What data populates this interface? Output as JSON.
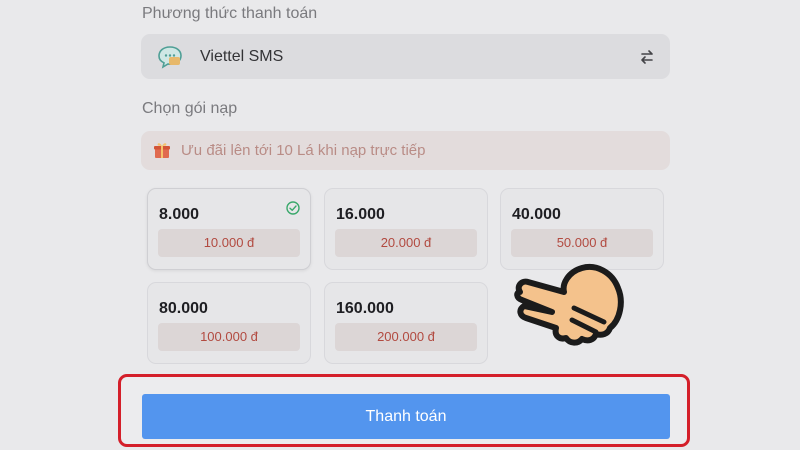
{
  "payment": {
    "label": "Phương thức thanh toán",
    "method_name": "Viettel SMS",
    "method_icon": "sms-chat-icon",
    "switch_icon": "swap-arrows-icon"
  },
  "package": {
    "label": "Chọn gói nạp",
    "promo_text": "Ưu đãi lên tới 10 Lá khi nạp trực tiếp",
    "promo_icon": "gift-icon",
    "options": [
      {
        "amount": "8.000",
        "price": "10.000 đ",
        "selected": true
      },
      {
        "amount": "16.000",
        "price": "20.000 đ",
        "selected": false
      },
      {
        "amount": "40.000",
        "price": "50.000 đ",
        "selected": false
      },
      {
        "amount": "80.000",
        "price": "100.000 đ",
        "selected": false
      },
      {
        "amount": "160.000",
        "price": "200.000 đ",
        "selected": false
      }
    ]
  },
  "actions": {
    "pay_label": "Thanh toán"
  },
  "colors": {
    "accent_blue": "#5395ee",
    "highlight_red": "#d41f2a",
    "price_red": "#b24a40",
    "check_green": "#3aa86b"
  }
}
